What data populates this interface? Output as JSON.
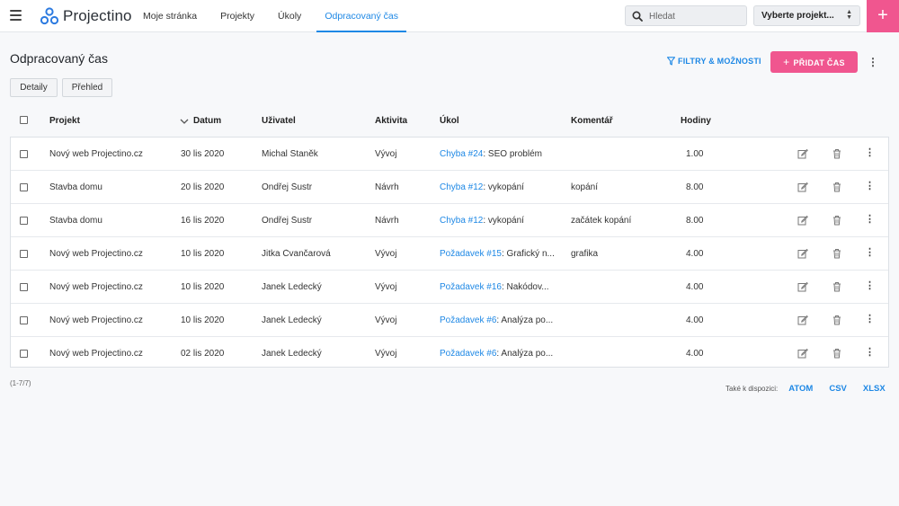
{
  "app": {
    "name": "Projectino"
  },
  "nav": [
    "Moje stránka",
    "Projekty",
    "Úkoly",
    "Odpracovaný čas"
  ],
  "search": {
    "placeholder": "Hledat"
  },
  "project_select": {
    "value": "Vyberte projekt..."
  },
  "page": {
    "title": "Odpracovaný čas",
    "filters_label": "FILTRY & MOŽNOSTI",
    "add_time_label": "PŘIDAT ČAS",
    "tabs": [
      "Detaily",
      "Přehled"
    ]
  },
  "table": {
    "columns": [
      "Projekt",
      "Datum",
      "Uživatel",
      "Aktivita",
      "Úkol",
      "Komentář",
      "Hodiny"
    ],
    "rows": [
      {
        "project": "Nový web Projectino.cz",
        "date": "30 lis 2020",
        "user": "Michal Staněk",
        "activity": "Vývoj",
        "task_link": "Chyba #24",
        "task_rest": ": SEO problém",
        "comment": "",
        "hours": "1.00"
      },
      {
        "project": "Stavba domu",
        "date": "20 lis 2020",
        "user": "Ondřej Šustr",
        "activity": "Návrh",
        "task_link": "Chyba #12",
        "task_rest": ": vykopání",
        "comment": "kopání",
        "hours": "8.00"
      },
      {
        "project": "Stavba domu",
        "date": "16 lis 2020",
        "user": "Ondřej Šustr",
        "activity": "Návrh",
        "task_link": "Chyba #12",
        "task_rest": ": vykopání",
        "comment": "začátek kopání",
        "hours": "8.00"
      },
      {
        "project": "Nový web Projectino.cz",
        "date": "10 lis 2020",
        "user": "Jitka Čvančarová",
        "activity": "Vývoj",
        "task_link": "Požadavek #15",
        "task_rest": ": Grafický n...",
        "comment": "grafika",
        "hours": "4.00"
      },
      {
        "project": "Nový web Projectino.cz",
        "date": "10 lis 2020",
        "user": "Janek Ledecký",
        "activity": "Vývoj",
        "task_link": "Požadavek #16",
        "task_rest": ": Nakódov...",
        "comment": "",
        "hours": "4.00"
      },
      {
        "project": "Nový web Projectino.cz",
        "date": "10 lis 2020",
        "user": "Janek Ledecký",
        "activity": "Vývoj",
        "task_link": "Požadavek #6",
        "task_rest": ": Analýza po...",
        "comment": "",
        "hours": "4.00"
      },
      {
        "project": "Nový web Projectino.cz",
        "date": "02 lis 2020",
        "user": "Janek Ledecký",
        "activity": "Vývoj",
        "task_link": "Požadavek #6",
        "task_rest": ": Analýza po...",
        "comment": "",
        "hours": "4.00"
      }
    ]
  },
  "footer": {
    "count": "(1-7/7)",
    "also_available": "Také k dispozici:",
    "formats": [
      "ATOM",
      "CSV",
      "XLSX"
    ]
  },
  "icons": {
    "menu": "hamburger-icon",
    "logo": "projectino-logo-icon",
    "search": "search-icon",
    "filter": "filter-icon",
    "edit": "edit-icon",
    "delete": "trash-icon",
    "more": "more-vertical-icon"
  },
  "colors": {
    "accent": "#1e88e5",
    "brand_pink": "#f0568f"
  }
}
